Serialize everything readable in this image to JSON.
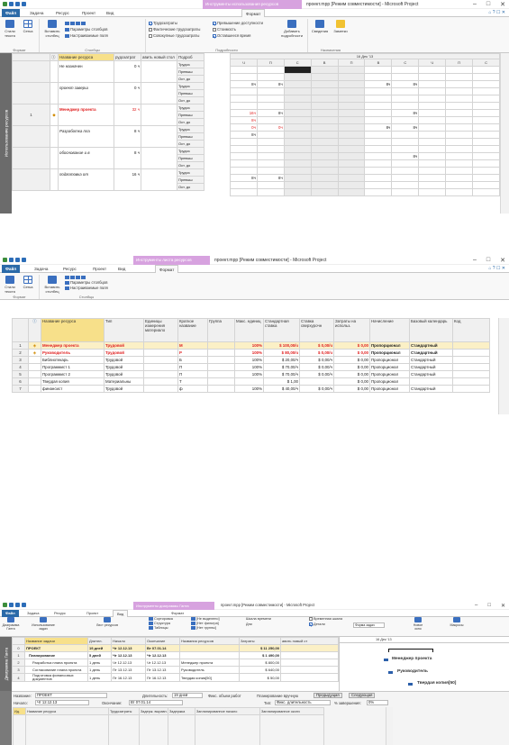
{
  "common": {
    "tabs": {
      "file": "Файл",
      "task": "Задача",
      "resource": "Ресурс",
      "project": "Проект",
      "view": "Вид",
      "format": "Формат"
    },
    "winbtns": {
      "min": "–",
      "max": "□",
      "close": "✕"
    }
  },
  "s1": {
    "context_tab": "Инструменты использования ресурсов",
    "window_title": "проект.mpp [Режим совместимости] - Microsoft Project",
    "ribbon": {
      "styles_label": "Стили текста",
      "grid_label": "Сетка",
      "insert_col_label": "Вставить столбец",
      "col_params": "Параметры столбцов",
      "custom_fields": "Настраиваемые поля",
      "cb_work": "Трудозатраты",
      "cb_actual_work": "Фактические трудозатраты",
      "cb_cum_work": "Совокупные трудозатраты",
      "cb_overalloc": "Превышение доступности",
      "cb_cost": "Стоимость",
      "cb_remain": "Оставшееся время",
      "add_details": "Добавить подробности",
      "info": "Сведения",
      "notes": "Заметки",
      "g_format": "Формат",
      "g_columns": "Столбцы",
      "g_details": "Подробности",
      "g_assign": "Назначения"
    },
    "sidebar": "Использование ресурсов",
    "headers": {
      "info": "i",
      "name": "Название ресурса",
      "work": "рудозатрат",
      "addcol": "авить новый стол",
      "details": "Подроб"
    },
    "timescale": {
      "week": "16 Дек '13",
      "days": [
        "Ч",
        "П",
        "С",
        "В",
        "П",
        "В",
        "С",
        "Ч",
        "П",
        "С"
      ]
    },
    "rows": [
      {
        "num": "",
        "ind": "",
        "name": "Не назначен",
        "work": "0 ч",
        "cls": "",
        "details": [
          {
            "lbl": "Трудоз",
            "vals": [
              "",
              "",
              "",
              "",
              "",
              "",
              "",
              "",
              "",
              ""
            ]
          },
          {
            "lbl": "Превыш",
            "vals": [
              "",
              "",
              "",
              "",
              "",
              "",
              "",
              "",
              "",
              ""
            ]
          },
          {
            "lbl": "Ост. до",
            "vals": [
              "8ч",
              "8ч",
              "",
              "",
              "",
              "8ч",
              "8ч",
              "",
              "",
              ""
            ]
          }
        ]
      },
      {
        "num": "",
        "ind": "",
        "name": "проект заверш",
        "work": "0 ч",
        "cls": "ital",
        "details": [
          {
            "lbl": "Трудоз",
            "vals": [
              "",
              "",
              "",
              "",
              "",
              "",
              "",
              "",
              "",
              ""
            ]
          },
          {
            "lbl": "Превыш",
            "vals": [
              "",
              "",
              "",
              "",
              "",
              "",
              "",
              "",
              "",
              ""
            ]
          },
          {
            "lbl": "Ост. до",
            "vals": [
              "",
              "",
              "",
              "",
              "",
              "",
              "",
              "",
              "",
              ""
            ]
          }
        ]
      },
      {
        "num": "1",
        "ind": "◆",
        "name": "Менеджер проекта",
        "work": "32 ч",
        "cls": "red bold",
        "details": [
          {
            "lbl": "Трудоз",
            "vals": [
              "16ч",
              "8ч",
              "",
              "",
              "",
              "",
              "8ч",
              "",
              "",
              ""
            ]
          },
          {
            "lbl": "Превыш",
            "vals": [
              "8ч",
              "",
              "",
              "",
              "",
              "",
              "",
              "",
              "",
              ""
            ]
          },
          {
            "lbl": "Ост. до",
            "vals": [
              "0ч",
              "0ч",
              "",
              "",
              "",
              "8ч",
              "8ч",
              "",
              "",
              ""
            ]
          }
        ]
      },
      {
        "num": "",
        "ind": "",
        "name": "Разработка пла",
        "work": "8 ч",
        "cls": "ital",
        "details": [
          {
            "lbl": "Трудоз",
            "vals": [
              "8ч",
              "",
              "",
              "",
              "",
              "",
              "",
              "",
              "",
              ""
            ]
          },
          {
            "lbl": "Превыш",
            "vals": [
              "",
              "",
              "",
              "",
              "",
              "",
              "",
              "",
              "",
              ""
            ]
          },
          {
            "lbl": "Ост. до",
            "vals": [
              "",
              "",
              "",
              "",
              "",
              "",
              "",
              "",
              "",
              ""
            ]
          }
        ]
      },
      {
        "num": "",
        "ind": "",
        "name": "обоснование и в",
        "work": "8 ч",
        "cls": "ital",
        "details": [
          {
            "lbl": "Трудоз",
            "vals": [
              "",
              "",
              "",
              "",
              "",
              "",
              "8ч",
              "",
              "",
              ""
            ]
          },
          {
            "lbl": "Превыш",
            "vals": [
              "",
              "",
              "",
              "",
              "",
              "",
              "",
              "",
              "",
              ""
            ]
          },
          {
            "lbl": "Ост. до",
            "vals": [
              "",
              "",
              "",
              "",
              "",
              "",
              "",
              "",
              "",
              ""
            ]
          }
        ]
      },
      {
        "num": "",
        "ind": "",
        "name": "подготовка от",
        "work": "16 ч",
        "cls": "ital",
        "details": [
          {
            "lbl": "Трудоз",
            "vals": [
              "8ч",
              "8ч",
              "",
              "",
              "",
              "",
              "",
              "",
              "",
              ""
            ]
          },
          {
            "lbl": "Превыш",
            "vals": [
              "",
              "",
              "",
              "",
              "",
              "",
              "",
              "",
              "",
              ""
            ]
          },
          {
            "lbl": "Ост. до",
            "vals": [
              "",
              "",
              "",
              "",
              "",
              "",
              "",
              "",
              "",
              ""
            ]
          }
        ]
      }
    ]
  },
  "s2": {
    "context_tab": "Инструменты листа ресурсов",
    "window_title": "проект.mpp [Режим совместимости] - Microsoft Project",
    "ribbon": {
      "styles_label": "Стили текста",
      "grid_label": "Сетка",
      "insert_col_label": "Вставить столбец",
      "col_params": "Параметры столбцов",
      "custom_fields": "Настраиваемые поля",
      "g_format": "Формат",
      "g_columns": "Столбцы"
    },
    "headers": [
      "",
      "Название ресурса",
      "Тип",
      "Единицы измерения материало",
      "Краткое название",
      "Группа",
      "Макс. единиц",
      "Стандартная ставка",
      "Ставка сверхурочн",
      "Затраты на использ.",
      "Начисление",
      "Базовый календарь",
      "Код"
    ],
    "rows": [
      {
        "num": "1",
        "ind": "◈",
        "name": "Менеджер проекта",
        "type": "Трудовой",
        "unit": "",
        "short": "М",
        "group": "",
        "max": "100%",
        "std": "$ 100,00/ч",
        "ovt": "$ 0,00/ч",
        "cost": "$ 0,00",
        "accr": "Пропорционал",
        "cal": "Стандартный",
        "cls": "red bold"
      },
      {
        "num": "2",
        "ind": "◈",
        "name": "Руководитель",
        "type": "Трудовой",
        "unit": "",
        "short": "Р",
        "group": "",
        "max": "100%",
        "std": "$ 80,00/ч",
        "ovt": "$ 0,00/ч",
        "cost": "$ 0,00",
        "accr": "Пропорционал",
        "cal": "Стандартный",
        "cls": "red bold"
      },
      {
        "num": "3",
        "ind": "",
        "name": "Библиотекарь",
        "type": "Трудовой",
        "unit": "",
        "short": "Б",
        "group": "",
        "max": "100%",
        "std": "$ 20,00/ч",
        "ovt": "$ 0,00/ч",
        "cost": "$ 0,00",
        "accr": "Пропорционал",
        "cal": "Стандартный",
        "cls": ""
      },
      {
        "num": "4",
        "ind": "",
        "name": "Программист 1",
        "type": "Трудовой",
        "unit": "",
        "short": "П",
        "group": "",
        "max": "100%",
        "std": "$ 70,00/ч",
        "ovt": "$ 0,00/ч",
        "cost": "$ 0,00",
        "accr": "Пропорционал",
        "cal": "Стандартный",
        "cls": ""
      },
      {
        "num": "5",
        "ind": "",
        "name": "Программист 2",
        "type": "Трудовой",
        "unit": "",
        "short": "П",
        "group": "",
        "max": "100%",
        "std": "$ 70,00/ч",
        "ovt": "$ 0,00/ч",
        "cost": "$ 0,00",
        "accr": "Пропорционал",
        "cal": "Стандартный",
        "cls": ""
      },
      {
        "num": "6",
        "ind": "",
        "name": "Твердая копия",
        "type": "Материальны",
        "unit": "",
        "short": "Т",
        "group": "",
        "max": "",
        "std": "$ 1,00",
        "ovt": "",
        "cost": "$ 0,00",
        "accr": "Пропорционал",
        "cal": "",
        "cls": ""
      },
      {
        "num": "7",
        "ind": "",
        "name": "финансист",
        "type": "Трудовой",
        "unit": "",
        "short": "ф",
        "group": "",
        "max": "100%",
        "std": "$ 40,00/ч",
        "ovt": "$ 0,00/ч",
        "cost": "$ 0,00",
        "accr": "Пропорционал",
        "cal": "Стандартный",
        "cls": ""
      }
    ]
  },
  "s3": {
    "context_tab": "Инструменты диаграммы Ганта",
    "window_title": "проект.mpp [Режим совместимости] - Microsoft Project",
    "tabs_gantt_file": "Файл",
    "ribbon": {
      "gantt_btn": "Диаграмма Ганта",
      "usage_btn": "Использование задач",
      "list_btn": "Лист ресурсов",
      "sort": "Сортировка",
      "structure": "Структура",
      "tables": "Таблицы",
      "highlight": "[Не выделено]",
      "filter": "[Нет фильтра]",
      "group": "[Нет группы]",
      "timescale": "Шкала времени",
      "days": "Дни",
      "timeline": "Временная шкала",
      "details": "Детали",
      "task_form": "Форма задач",
      "new_window": "Новое окно",
      "macros": "Макросы",
      "g_task_views": "Представления задач",
      "g_res_views": "Представления ресурсов",
      "g_data": "Данные",
      "g_scale": "Масштаб",
      "g_split": "Комбинированный режим",
      "g_window": "Окно",
      "g_macros": "Макросы"
    },
    "sidebar": "Диаграмма Ганта",
    "headers": [
      "",
      "Название задачи",
      "Длител.",
      "Начало",
      "Окончание",
      "Названия ресурсов",
      "Затраты",
      "авить новый ст"
    ],
    "rows": [
      {
        "num": "0",
        "name": "ПРОЕКТ",
        "dur": "19 дней",
        "start": "Чт 12.12.13",
        "end": "Вт 07.01.14",
        "res": "",
        "cost": "$ 11 250,00",
        "cls": "bold",
        "hl": true
      },
      {
        "num": "1",
        "name": "Планирование",
        "dur": "5 дней",
        "start": "Чт 12.12.13",
        "end": "Чт 12.12.13",
        "res": "",
        "cost": "$ 1 490,00",
        "cls": "bold",
        "hl": false
      },
      {
        "num": "2",
        "name": "Разработка плана проекта",
        "dur": "1 день",
        "start": "Чт 12.12.13",
        "end": "Чт 12.12.13",
        "res": "Менеджер проекта",
        "cost": "$ 800,00",
        "cls": "",
        "hl": false
      },
      {
        "num": "3",
        "name": "Согласование плана проекта",
        "dur": "1 день",
        "start": "Пт 13.12.13",
        "end": "Пт 13.12.13",
        "res": "Руководитель",
        "cost": "$ 640,00",
        "cls": "",
        "hl": false
      },
      {
        "num": "4",
        "name": "Подготовка финансовых документов",
        "dur": "1 день",
        "start": "Пт 16.12.13",
        "end": "Пт 16.12.13",
        "res": "Твердая копия[50]",
        "cost": "$ 50,00",
        "cls": "",
        "hl": false
      }
    ],
    "gantt": {
      "week": "16 Дек '13",
      "labels": [
        "Менеджер проекта",
        "Руководитель",
        "Твердая копия[50]"
      ]
    },
    "form": {
      "name_lbl": "Название:",
      "name_val": "ПРОЕКТ",
      "dur_lbl": "Длительность:",
      "dur_val": "19 дней",
      "effort": "Фикс. объем работ",
      "manual": "Планирование вручную",
      "prev": "Предыдущая",
      "next": "Следующая",
      "start_lbl": "Начало:",
      "start_val": "Чт 12.12.13",
      "end_lbl": "Окончание:",
      "end_val": "Вт 07.01.14",
      "type_lbl": "Тип:",
      "type_val": "Фикс. длительность",
      "pct_lbl": "% завершения:",
      "pct_val": "0%",
      "col_num": "Ид.",
      "col_res": "Название ресурса",
      "col_work": "Трудозатраты",
      "col_delay": "Задерж. выравн.",
      "col_lag": "Задержка",
      "col_start": "Запланированное начало",
      "col_end": "Запланированное оконч"
    }
  }
}
